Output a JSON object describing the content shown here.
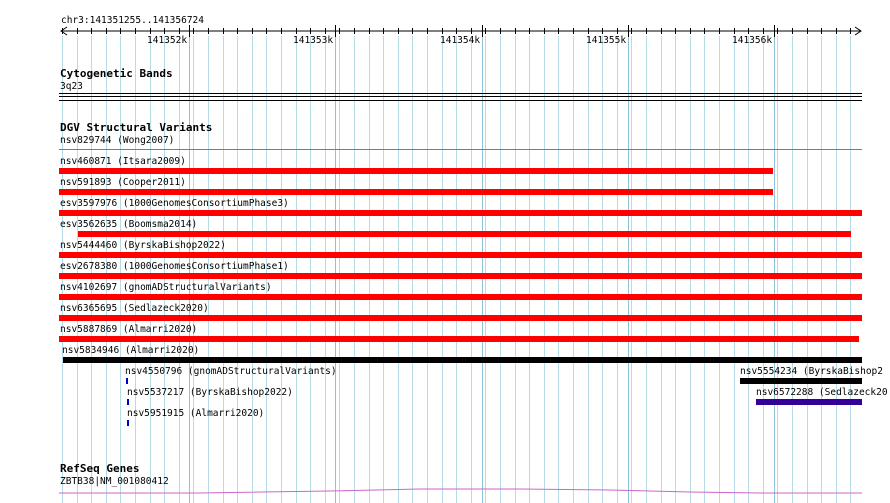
{
  "ruler": {
    "range_label": "chr3:141351255..141356724",
    "ticks": [
      "141352k",
      "141353k",
      "141354k",
      "141355k",
      "141356k"
    ]
  },
  "tracks": {
    "cytogenetic": {
      "title": "Cytogenetic Bands",
      "band_label": "3q23"
    },
    "dgv": {
      "title": "DGV Structural Variants",
      "features": [
        "nsv829744 (Wong2007)",
        "nsv460871 (Itsara2009)",
        "nsv591893 (Cooper2011)",
        "esv3597976 (1000GenomesConsortiumPhase3)",
        "esv3562635 (Boomsma2014)",
        "nsv5444460 (ByrskaBishop2022)",
        "esv2678380 (1000GenomesConsortiumPhase1)",
        "nsv4102697 (gnomADStructuralVariants)",
        "nsv6365695 (Sedlazeck2020)",
        "nsv5887869 (Almarri2020)",
        "nsv5834946 (Almarri2020)",
        "nsv4550796 (gnomADStructuralVariants)",
        "nsv5537217 (ByrskaBishop2022)",
        "nsv5951915 (Almarri2020)",
        "nsv5554234 (ByrskaBishop2",
        "nsv6572288 (Sedlazeck20"
      ]
    },
    "refseq": {
      "title": "RefSeq Genes",
      "gene_label": "ZBTB38|NM_001080412"
    }
  },
  "colors": {
    "loss": "#ff0000",
    "complex": "#000000",
    "gain": "#0000cc",
    "inversion": "#330099",
    "grid": "#b8dbe8",
    "gene": "#cc66cc"
  }
}
